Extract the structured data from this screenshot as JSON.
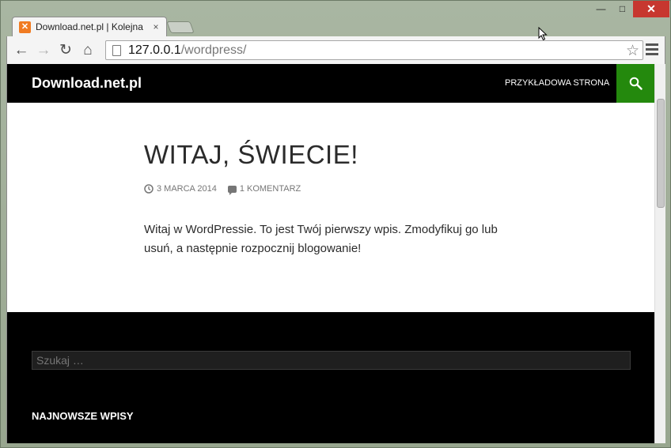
{
  "browser": {
    "tab": {
      "favicon": "xampp-icon",
      "title": "Download.net.pl | Kolejna",
      "close": "×"
    },
    "window_controls": {
      "minimize": "—",
      "maximize": "□",
      "close": "✕"
    },
    "toolbar": {
      "back_icon": "←",
      "forward_icon": "→",
      "reload_icon": "↻",
      "home_icon": "⌂",
      "url_host": "127.0.0.1",
      "url_path": "/wordpress/",
      "star_icon": "☆"
    }
  },
  "site": {
    "title": "Download.net.pl",
    "nav_link": "PRZYKŁADOWA STRONA",
    "accent_color": "#24890d"
  },
  "post": {
    "title": "WITAJ, ŚWIECIE!",
    "date": "3 MARCA 2014",
    "comments": "1 KOMENTARZ",
    "content": "Witaj w WordPressie. To jest Twój pierwszy wpis. Zmodyfikuj go lub usuń, a następnie rozpocznij blogowanie!"
  },
  "footer": {
    "search_placeholder": "Szukaj …",
    "widget_title": "NAJNOWSZE WPISY"
  }
}
